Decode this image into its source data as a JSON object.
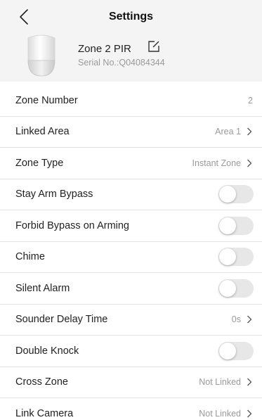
{
  "header": {
    "title": "Settings",
    "back_icon": "chevron-left-icon"
  },
  "device": {
    "name": "Zone 2 PIR",
    "serial": "Serial No.:Q04084344",
    "edit_icon": "edit-icon",
    "image_icon": "pir-sensor-icon"
  },
  "settings": [
    {
      "label": "Zone Number",
      "value": "2",
      "kind": "value"
    },
    {
      "label": "Linked Area",
      "value": "Area 1",
      "kind": "link"
    },
    {
      "label": "Zone Type",
      "value": "Instant Zone",
      "kind": "link"
    },
    {
      "label": "Stay Arm Bypass",
      "kind": "toggle",
      "on": false
    },
    {
      "label": "Forbid Bypass on Arming",
      "kind": "toggle",
      "on": false
    },
    {
      "label": "Chime",
      "kind": "toggle",
      "on": false
    },
    {
      "label": "Silent Alarm",
      "kind": "toggle",
      "on": false
    },
    {
      "label": "Sounder Delay Time",
      "value": "0s",
      "kind": "link"
    },
    {
      "label": "Double Knock",
      "kind": "toggle",
      "on": false
    },
    {
      "label": "Cross Zone",
      "value": "Not Linked",
      "kind": "link"
    },
    {
      "label": "Link Camera",
      "value": "Not Linked",
      "kind": "link"
    }
  ],
  "colors": {
    "header_bg": "#f4f4f4",
    "toggle_off": "#e7e7e7",
    "secondary_text": "#9a9a9a"
  }
}
